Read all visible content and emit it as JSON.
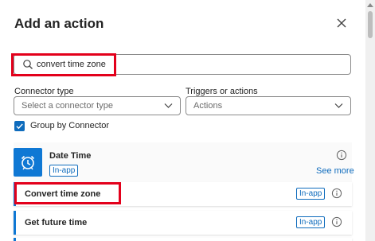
{
  "header": {
    "title": "Add an action"
  },
  "search": {
    "value": "convert time zone",
    "placeholder": ""
  },
  "filters": {
    "connector_type_label": "Connector type",
    "connector_type_value": "Select a connector type",
    "triggers_label": "Triggers or actions",
    "triggers_value": "Actions"
  },
  "group_by": {
    "label": "Group by Connector",
    "checked": true
  },
  "connector": {
    "name": "Date Time",
    "badge": "In-app",
    "see_more": "See more",
    "icon": "alarm-clock-icon"
  },
  "actions": [
    {
      "label": "Convert time zone",
      "badge": "In-app"
    },
    {
      "label": "Get future time",
      "badge": "In-app"
    }
  ],
  "colors": {
    "accent": "#0f6cbd",
    "connector_icon_bg": "#0f78d4",
    "highlight": "#e3001b"
  }
}
